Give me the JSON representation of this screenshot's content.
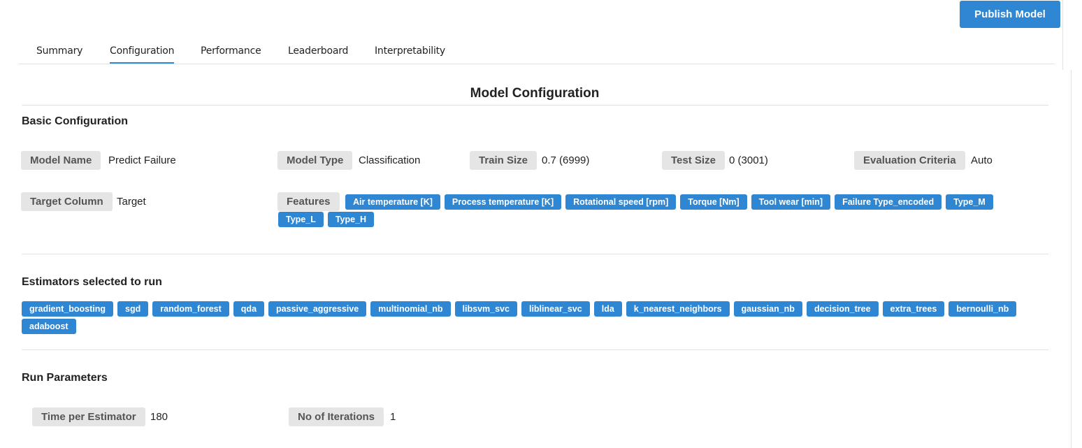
{
  "header": {
    "publish_label": "Publish Model"
  },
  "tabs": [
    {
      "label": "Summary",
      "active": false
    },
    {
      "label": "Configuration",
      "active": true
    },
    {
      "label": "Performance",
      "active": false
    },
    {
      "label": "Leaderboard",
      "active": false
    },
    {
      "label": "Interpretability",
      "active": false
    }
  ],
  "page_title": "Model Configuration",
  "basic": {
    "title": "Basic Configuration",
    "model_name_label": "Model Name",
    "model_name": "Predict Failure",
    "model_type_label": "Model Type",
    "model_type": "Classification",
    "train_size_label": "Train Size",
    "train_size": "0.7 (6999)",
    "test_size_label": "Test Size",
    "test_size": "0 (3001)",
    "eval_label": "Evaluation Criteria",
    "eval": "Auto",
    "target_label": "Target Column",
    "target": "Target",
    "features_label": "Features",
    "features": [
      "Air temperature [K]",
      "Process temperature [K]",
      "Rotational speed [rpm]",
      "Torque [Nm]",
      "Tool wear [min]",
      "Failure Type_encoded",
      "Type_M",
      "Type_L",
      "Type_H"
    ]
  },
  "estimators": {
    "title": "Estimators selected to run",
    "items": [
      "gradient_boosting",
      "sgd",
      "random_forest",
      "qda",
      "passive_aggressive",
      "multinomial_nb",
      "libsvm_svc",
      "liblinear_svc",
      "lda",
      "k_nearest_neighbors",
      "gaussian_nb",
      "decision_tree",
      "extra_trees",
      "bernoulli_nb",
      "adaboost"
    ]
  },
  "run": {
    "title": "Run Parameters",
    "time_label": "Time per Estimator",
    "time": "180",
    "iter_label": "No of Iterations",
    "iter": "1"
  },
  "colors": {
    "accent": "#2f86d2",
    "chip_bg": "#e5e5e5",
    "divider": "#e2e2e2"
  }
}
